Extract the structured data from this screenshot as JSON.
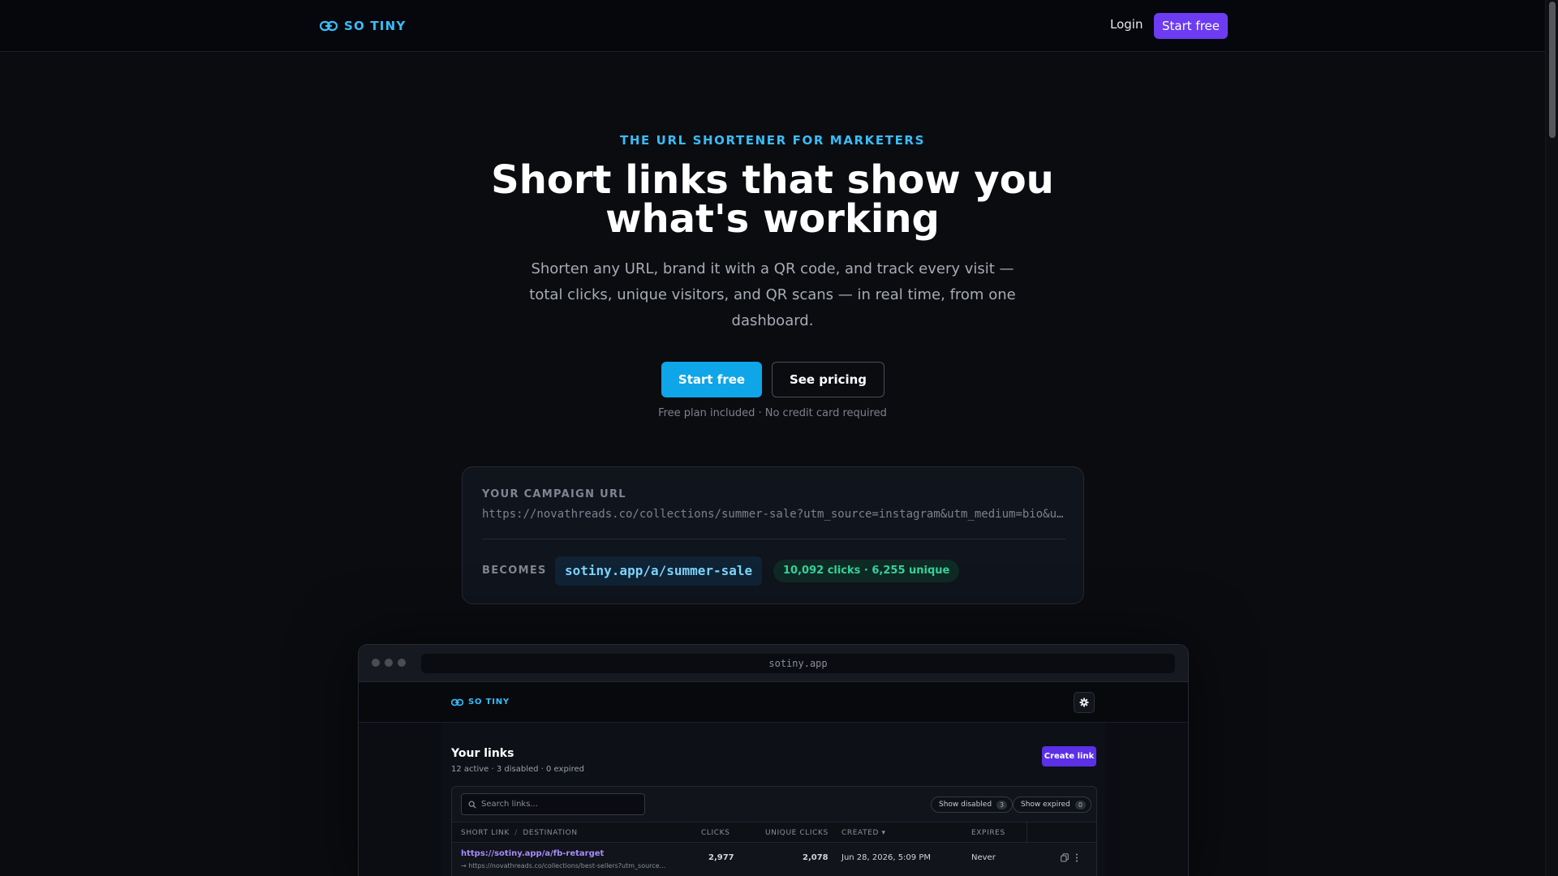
{
  "nav": {
    "brand": "SO TINY",
    "login": "Login",
    "start_free": "Start free"
  },
  "hero": {
    "eyebrow": "THE URL SHORTENER FOR MARKETERS",
    "title": "Short links that show you what's working",
    "subtitle": "Shorten any URL, brand it with a QR code, and track every visit — total clicks, unique visitors, and QR scans — in real time, from one dashboard.",
    "cta_primary": "Start free",
    "cta_secondary": "See pricing",
    "note": "Free plan included · No credit card required"
  },
  "campaign": {
    "label": "YOUR CAMPAIGN URL",
    "url": "https://novathreads.co/collections/summer-sale?utm_source=instagram&utm_medium=bio&utm_campaign=summer",
    "becomes_label": "BECOMES",
    "short_link": "sotiny.app/a/summer-sale",
    "stats": "10,092 clicks · 6,255 unique"
  },
  "browser": {
    "address": "sotiny.app",
    "app_brand": "SO TINY",
    "links_title": "Your links",
    "links_subtitle": "12 active · 3 disabled · 0 expired",
    "create_label": "Create link",
    "search_placeholder": "Search links...",
    "show_disabled_label": "Show disabled",
    "show_disabled_count": "3",
    "show_expired_label": "Show expired",
    "show_expired_count": "0",
    "columns": {
      "short_link": "SHORT LINK",
      "sep": "/",
      "destination": "DESTINATION",
      "clicks": "CLICKS",
      "unique_clicks": "UNIQUE CLICKS",
      "created": "CREATED ▾",
      "expires": "EXPIRES"
    },
    "rows": [
      {
        "short_link": "https://sotiny.app/a/fb-retarget",
        "destination": "→ https://novathreads.co/collections/best-sellers?utm_source...",
        "clicks": "2,977",
        "unique_clicks": "2,078",
        "created": "Jun 28, 2026, 5:09 PM",
        "expires": "Never"
      }
    ]
  },
  "colors": {
    "background": "#0b0c10",
    "accent_sky": "#38bdf8",
    "accent_purple": "#6d3cf2",
    "cta_blue": "#0ea5e9",
    "success_green": "#34d399"
  },
  "icons": [
    "link-icon",
    "gear-icon",
    "search-icon",
    "copy-icon",
    "more-icon"
  ]
}
